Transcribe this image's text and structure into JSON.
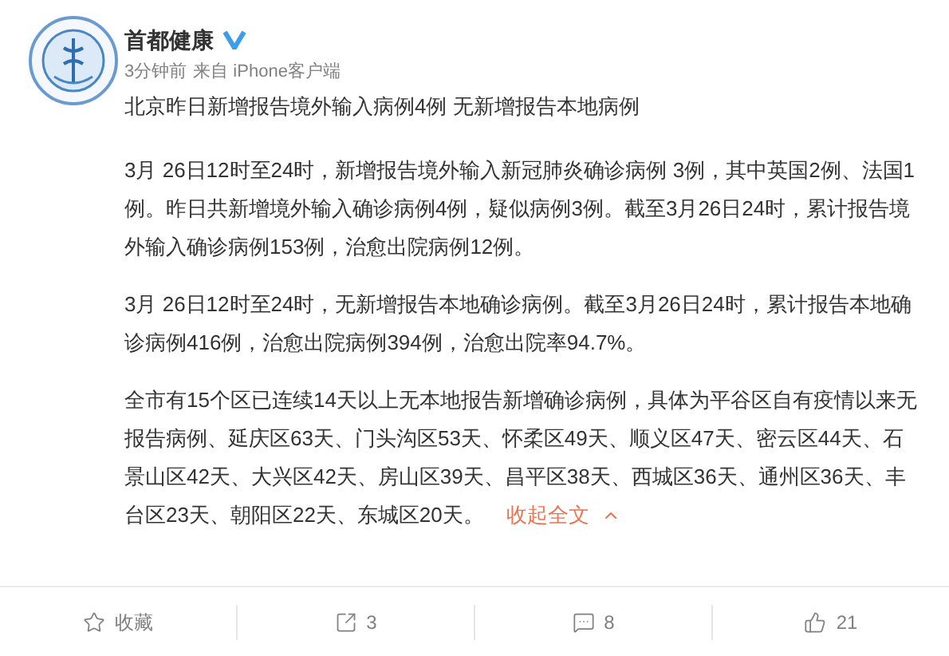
{
  "author": {
    "name": "首都健康",
    "verified": true
  },
  "meta": {
    "time": "3分钟前",
    "source": "来自 iPhone客户端"
  },
  "headline": "北京昨日新增报告境外输入病例4例 无新增报告本地病例",
  "paragraphs": [
    "3月 26日12时至24时，新增报告境外输入新冠肺炎确诊病例 3例，其中英国2例、法国1例。昨日共新增境外输入确诊病例4例，疑似病例3例。截至3月26日24时，累计报告境外输入确诊病例153例，治愈出院病例12例。",
    "3月 26日12时至24时，无新增报告本地确诊病例。截至3月26日24时，累计报告本地确诊病例416例，治愈出院病例394例，治愈出院率94.7%。",
    "全市有15个区已连续14天以上无本地报告新增确诊病例，具体为平谷区自有疫情以来无报告病例、延庆区63天、门头沟区53天、怀柔区49天、顺义区47天、密云区44天、石景山区42天、大兴区42天、房山区39天、昌平区38天、西城区36天、通州区36天、丰台区23天、朝阳区22天、东城区20天。"
  ],
  "collapse_link": "收起全文",
  "actions": [
    {
      "kind": "favorite",
      "label": "收藏"
    },
    {
      "kind": "repost",
      "label": "3"
    },
    {
      "kind": "comment",
      "label": "8"
    },
    {
      "kind": "like",
      "label": "21"
    }
  ]
}
